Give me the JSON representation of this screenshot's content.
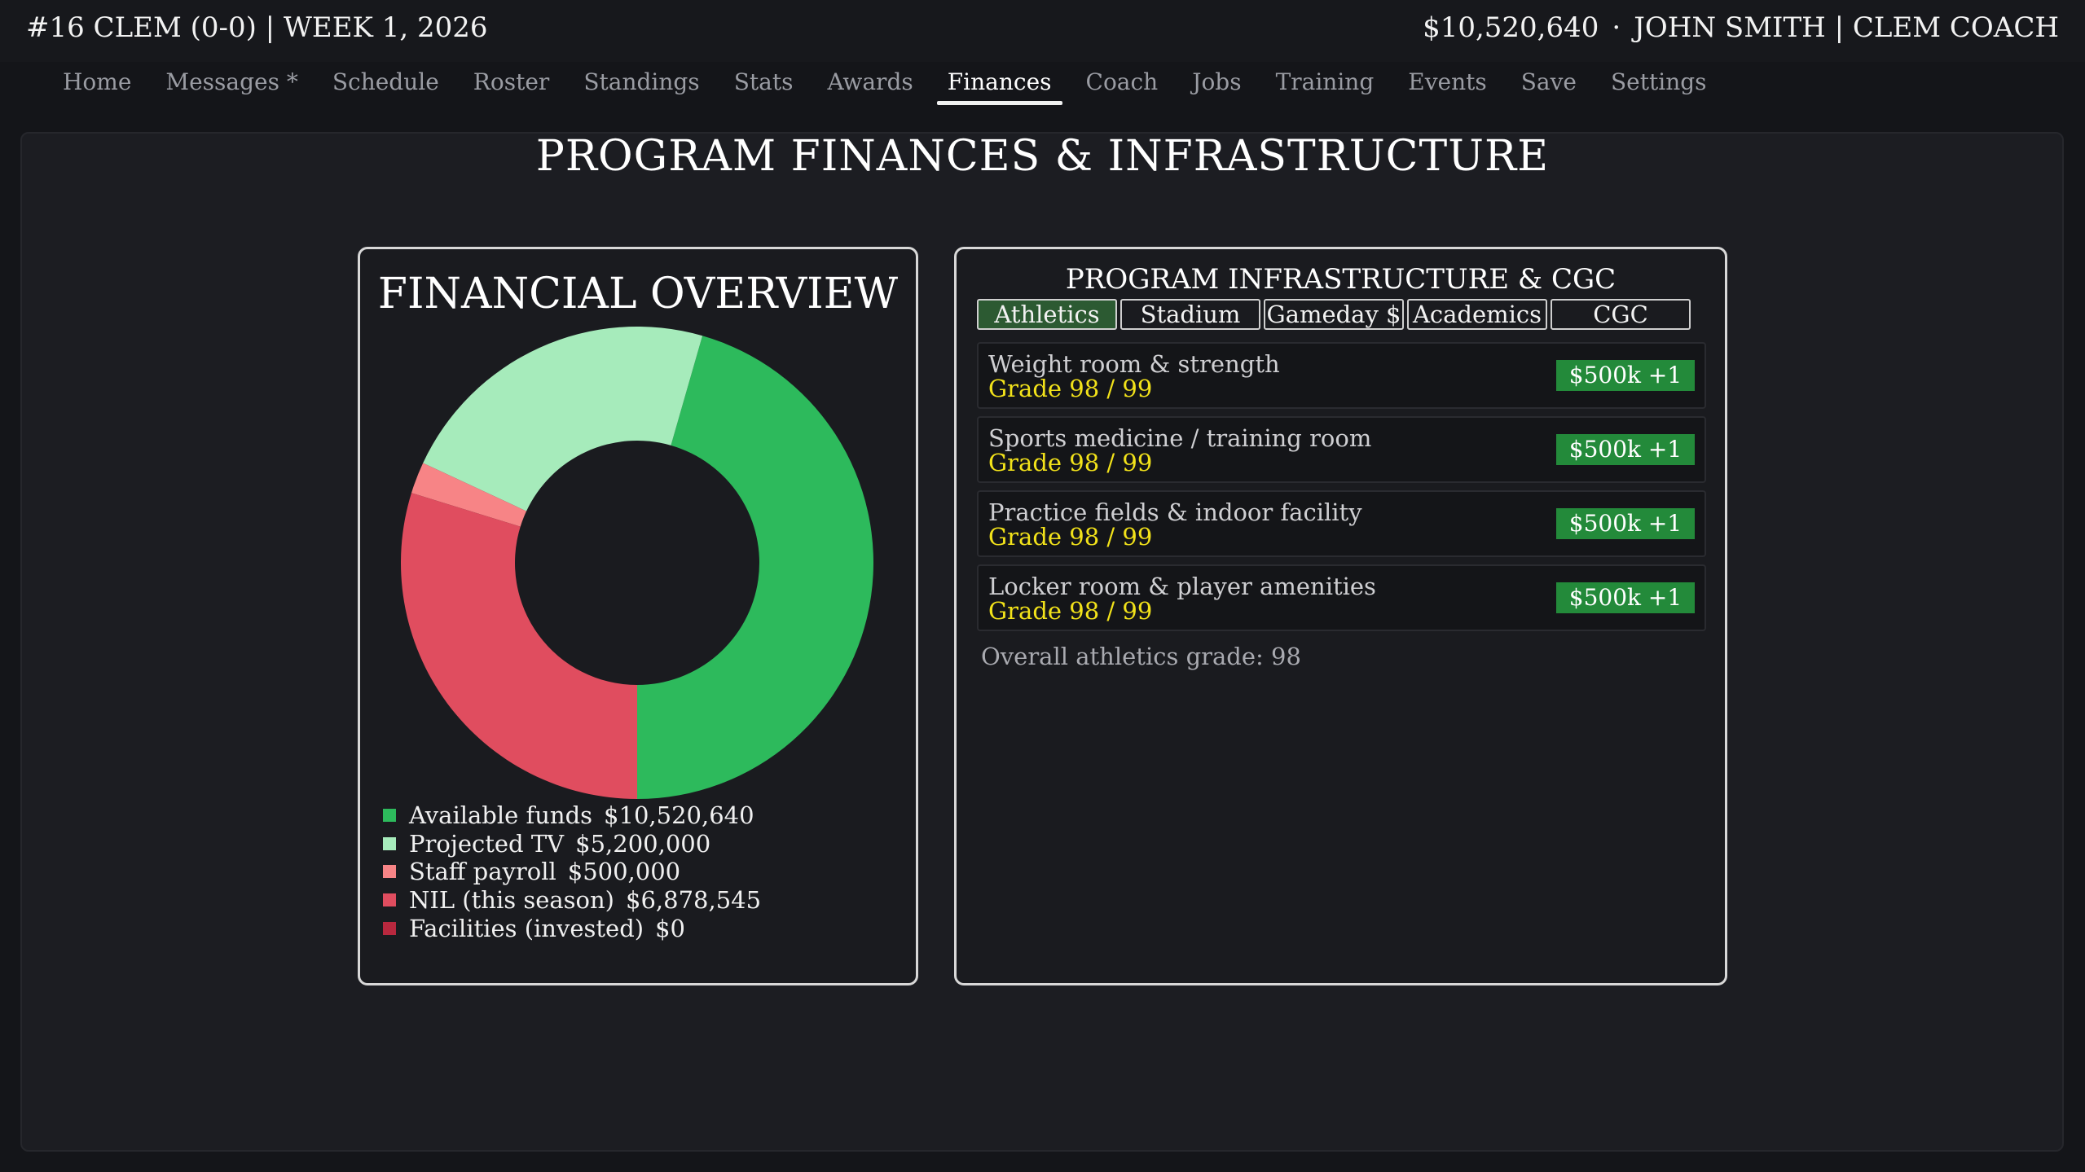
{
  "header": {
    "team_status": "#16 CLEM (0-0) | WEEK 1, 2026",
    "funds": "$10,520,640",
    "separator": "·",
    "coach": "JOHN SMITH | CLEM COACH"
  },
  "nav": {
    "items": [
      "Home",
      "Messages *",
      "Schedule",
      "Roster",
      "Standings",
      "Stats",
      "Awards",
      "Finances",
      "Coach",
      "Jobs",
      "Training",
      "Events",
      "Save",
      "Settings"
    ],
    "active": "Finances"
  },
  "page": {
    "title": "PROGRAM FINANCES & INFRASTRUCTURE"
  },
  "financial_overview": {
    "title": "FINANCIAL OVERVIEW",
    "legend": [
      {
        "label": "Available funds",
        "value": "$10,520,640",
        "color": "#2dba5c"
      },
      {
        "label": "Projected TV",
        "value": "$5,200,000",
        "color": "#a6ebbb"
      },
      {
        "label": "Staff payroll",
        "value": "$500,000",
        "color": "#f78486"
      },
      {
        "label": "NIL (this season)",
        "value": "$6,878,545",
        "color": "#e04d5f"
      },
      {
        "label": "Facilities (invested)",
        "value": "$0",
        "color": "#b8283e"
      }
    ]
  },
  "chart_data": {
    "type": "pie",
    "donut": true,
    "title": "FINANCIAL OVERVIEW",
    "categories": [
      "Available funds",
      "Projected TV",
      "Staff payroll",
      "NIL (this season)",
      "Facilities (invested)"
    ],
    "values": [
      10520640,
      5200000,
      500000,
      6878545,
      0
    ],
    "colors": [
      "#2dba5c",
      "#a6ebbb",
      "#f78486",
      "#e04d5f",
      "#b8283e"
    ],
    "legend": "bottom-left"
  },
  "infrastructure": {
    "title": "PROGRAM INFRASTRUCTURE & CGC",
    "tabs": [
      "Athletics",
      "Stadium",
      "Gameday $",
      "Academics",
      "CGC"
    ],
    "active_tab": "Athletics",
    "items": [
      {
        "name": "Weight room & strength",
        "grade": "Grade 98 / 99",
        "button": "$500k +1"
      },
      {
        "name": "Sports medicine / training room",
        "grade": "Grade 98 / 99",
        "button": "$500k +1"
      },
      {
        "name": "Practice fields & indoor facility",
        "grade": "Grade 98 / 99",
        "button": "$500k +1"
      },
      {
        "name": "Locker room & player amenities",
        "grade": "Grade 98 / 99",
        "button": "$500k +1"
      }
    ],
    "overall": "Overall athletics grade: 98"
  }
}
